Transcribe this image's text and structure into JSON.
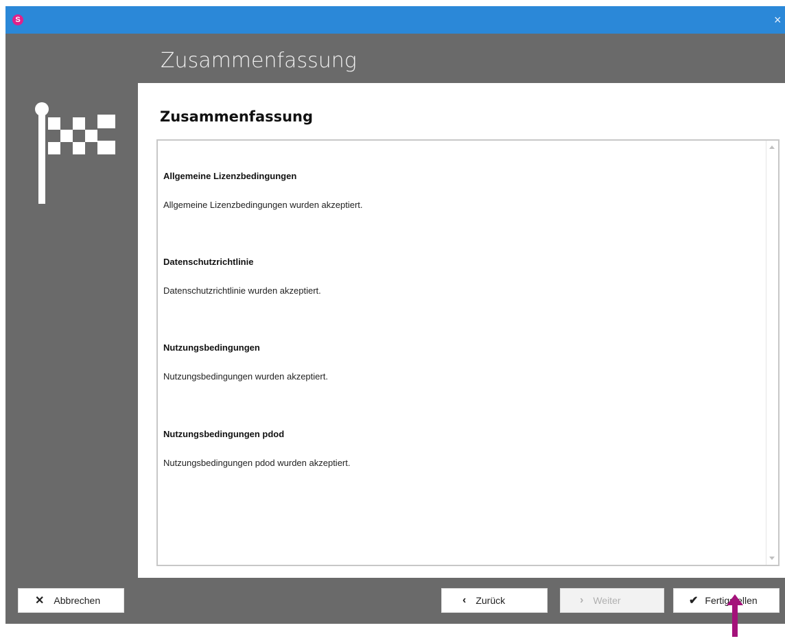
{
  "titlebar": {
    "logo_letter": "S",
    "close_symbol": "×"
  },
  "header": {
    "title": "Zusammenfassung"
  },
  "sidebar": {
    "icon": "checkered-flag-icon"
  },
  "content": {
    "title": "Zusammenfassung",
    "sections": [
      {
        "title": "Allgemeine Lizenzbedingungen",
        "text": "Allgemeine Lizenzbedingungen wurden akzeptiert."
      },
      {
        "title": "Datenschutzrichtlinie",
        "text": "Datenschutzrichtlinie wurden akzeptiert."
      },
      {
        "title": "Nutzungsbedingungen",
        "text": "Nutzungsbedingungen wurden akzeptiert."
      },
      {
        "title": "Nutzungsbedingungen pdod",
        "text": "Nutzungsbedingungen pdod wurden akzeptiert."
      }
    ]
  },
  "footer": {
    "cancel_label": "Abbrechen",
    "back_label": "Zurück",
    "next_label": "Weiter",
    "finish_label": "Fertigstellen"
  },
  "colors": {
    "titlebar": "#2b88d8",
    "frame": "#6a6a6a",
    "logo": "#e0218a",
    "annotation_arrow": "#a4127a"
  }
}
